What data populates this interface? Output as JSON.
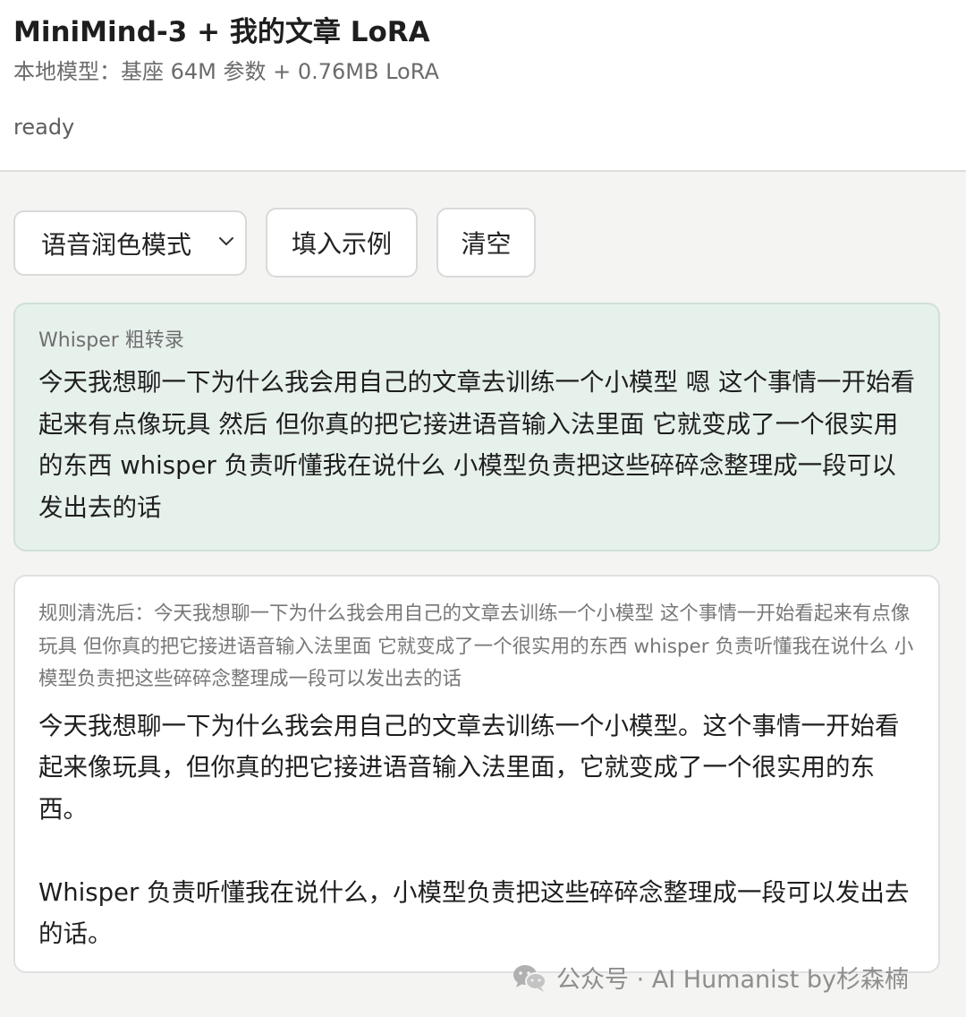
{
  "header": {
    "title": "MiniMind-3 + 我的文章 LoRA",
    "subtitle": "本地模型：基座 64M 参数 + 0.76MB LoRA",
    "status": "ready"
  },
  "toolbar": {
    "mode_select_value": "语音润色模式",
    "fill_example_label": "填入示例",
    "clear_label": "清空"
  },
  "raw_transcript": {
    "label": "Whisper 粗转录",
    "text": "今天我想聊一下为什么我会用自己的文章去训练一个小模型 嗯 这个事情一开始看起来有点像玩具 然后 但你真的把它接进语音输入法里面 它就变成了一个很实用的东西 whisper 负责听懂我在说什么 小模型负责把这些碎碎念整理成一段可以发出去的话"
  },
  "cleaned": {
    "rule_text": "规则清洗后：今天我想聊一下为什么我会用自己的文章去训练一个小模型 这个事情一开始看起来有点像玩具 但你真的把它接进语音输入法里面 它就变成了一个很实用的东西 whisper 负责听懂我在说什么 小模型负责把这些碎碎念整理成一段可以发出去的话",
    "paragraphs": [
      "今天我想聊一下为什么我会用自己的文章去训练一个小模型。这个事情一开始看起来像玩具，但你真的把它接进语音输入法里面，它就变成了一个很实用的东西。",
      "Whisper 负责听懂我在说什么，小模型负责把这些碎碎念整理成一段可以发出去的话。"
    ]
  },
  "watermark": {
    "text": "公众号 · AI Humanist by杉森楠",
    "icon": "wechat-icon"
  }
}
